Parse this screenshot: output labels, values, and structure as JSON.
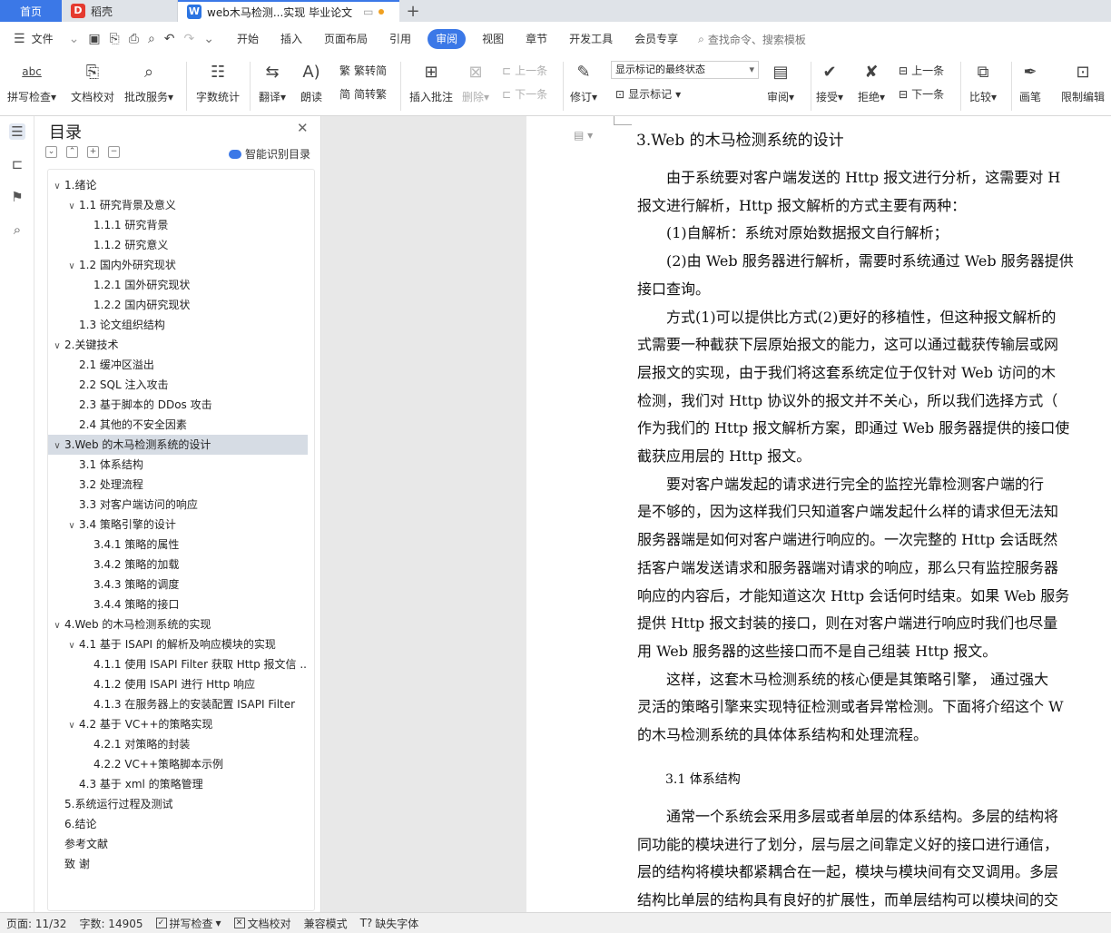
{
  "tabs": {
    "home": "首页",
    "daoke": "稻壳",
    "doc": "web木马检测...实现 毕业论文",
    "daoke_logo": "D",
    "doc_logo": "W"
  },
  "menubar": {
    "file": "文件",
    "items": [
      "开始",
      "插入",
      "页面布局",
      "引用",
      "审阅",
      "视图",
      "章节",
      "开发工具",
      "会员专享"
    ],
    "active": "审阅",
    "search": "查找命令、搜索模板"
  },
  "toolbar": {
    "spellcheck": "拼写检查",
    "proofread": "文档校对",
    "annotate_service": "批改服务",
    "word_count": "字数统计",
    "translate": "翻译",
    "read_aloud": "朗读",
    "to_traditional": "繁转简",
    "to_simplified": "简转繁",
    "insert_comment": "插入批注",
    "delete": "删除",
    "prev_comment": "上一条",
    "next_comment": "下一条",
    "revise": "修订",
    "markup_combo": "显示标记的最终状态",
    "show_markup": "显示标记",
    "review": "审阅",
    "accept": "接受",
    "reject": "拒绝",
    "prev_change": "上一条",
    "next_change": "下一条",
    "compare": "比较",
    "draw": "画笔",
    "restrict_edit": "限制编辑",
    "spell_icon_text": "abc"
  },
  "panel": {
    "title": "目录",
    "smart": "智能识别目录",
    "items": [
      {
        "text": "1.绪论",
        "level": 0,
        "toggle": "∨"
      },
      {
        "text": "1.1  研究背景及意义",
        "level": 1,
        "toggle": "∨"
      },
      {
        "text": "1.1.1 研究背景",
        "level": 2
      },
      {
        "text": "1.1.2  研究意义",
        "level": 2
      },
      {
        "text": "1.2  国内外研究现状",
        "level": 1,
        "toggle": "∨"
      },
      {
        "text": "1.2.1  国外研究现状",
        "level": 2
      },
      {
        "text": "1.2.2  国内研究现状",
        "level": 2
      },
      {
        "text": "1.3  论文组织结构",
        "level": 1
      },
      {
        "text": "2.关键技术",
        "level": 0,
        "toggle": "∨"
      },
      {
        "text": "2.1 缓冲区溢出",
        "level": 1
      },
      {
        "text": "2.2 SQL 注入攻击",
        "level": 1
      },
      {
        "text": "2.3 基于脚本的 DDos 攻击",
        "level": 1
      },
      {
        "text": "2.4 其他的不安全因素",
        "level": 1
      },
      {
        "text": "3.Web 的木马检测系统的设计",
        "level": 0,
        "toggle": "∨",
        "selected": true
      },
      {
        "text": "3.1 体系结构",
        "level": 1
      },
      {
        "text": "3.2 处理流程",
        "level": 1
      },
      {
        "text": "3.3 对客户端访问的响应",
        "level": 1
      },
      {
        "text": "3.4 策略引擎的设计",
        "level": 1,
        "toggle": "∨"
      },
      {
        "text": "3.4.1 策略的属性",
        "level": 2
      },
      {
        "text": "3.4.2 策略的加载",
        "level": 2
      },
      {
        "text": "3.4.3 策略的调度",
        "level": 2
      },
      {
        "text": "3.4.4 策略的接口",
        "level": 2
      },
      {
        "text": "4.Web 的木马检测系统的实现",
        "level": 0,
        "toggle": "∨"
      },
      {
        "text": "4.1 基于 ISAPI  的解析及响应模块的实现",
        "level": 1,
        "toggle": "∨"
      },
      {
        "text": "4.1.1 使用 ISAPI Filter 获取 Http 报文信 ...",
        "level": 2
      },
      {
        "text": "4.1.2 使用 ISAPI 进行 Http 响应",
        "level": 2
      },
      {
        "text": "4.1.3 在服务器上的安装配置 ISAPI Filter",
        "level": 2
      },
      {
        "text": "4.2 基于 VC++的策略实现",
        "level": 1,
        "toggle": "∨"
      },
      {
        "text": "4.2.1 对策略的封装",
        "level": 2
      },
      {
        "text": "4.2.2 VC++策略脚本示例",
        "level": 2
      },
      {
        "text": "4.3 基于 xml 的策略管理",
        "level": 1
      },
      {
        "text": "5.系统运行过程及测试",
        "level": 0
      },
      {
        "text": "6.结论",
        "level": 0
      },
      {
        "text": "参考文献",
        "level": 0
      },
      {
        "text": "致   谢",
        "level": 0
      }
    ]
  },
  "doc": {
    "heading": "3.Web 的木马检测系统的设计",
    "lines": [
      "　　由于系统要对客户端发送的 Http 报文进行分析，这需要对 H",
      "报文进行解析，Http 报文解析的方式主要有两种：",
      "　　(1)自解析：系统对原始数据报文自行解析；",
      "　　(2)由 Web 服务器进行解析，需要时系统通过 Web 服务器提供",
      "接口查询。",
      "　　方式(1)可以提供比方式(2)更好的移植性，但这种报文解析的",
      "式需要一种截获下层原始报文的能力，这可以通过截获传输层或网",
      "层报文的实现，由于我们将这套系统定位于仅针对 Web 访问的木",
      "检测，我们对 Http 协议外的报文并不关心，所以我们选择方式（",
      "作为我们的 Http 报文解析方案，即通过 Web 服务器提供的接口使",
      "截获应用层的 Http 报文。",
      "　　要对客户端发起的请求进行完全的监控光靠检测客户端的行",
      "是不够的，因为这样我们只知道客户端发起什么样的请求但无法知",
      "服务器端是如何对客户端进行响应的。一次完整的 Http 会话既然",
      "括客户端发送请求和服务器端对请求的响应，那么只有监控服务器",
      "响应的内容后，才能知道这次 Http 会话何时结束。如果 Web 服务",
      "提供 Http 报文封装的接口，则在对客户端进行响应时我们也尽量",
      "用 Web 服务器的这些接口而不是自己组装 Http 报文。",
      "　　这样，这套木马检测系统的核心便是其策略引擎，  通过强大",
      "灵活的策略引擎来实现特征检测或者异常检测。下面将介绍这个 W",
      "的木马检测系统的具体体系结构和处理流程。"
    ],
    "subheading": "3.1 体系结构",
    "lines2": [
      "　　通常一个系统会采用多层或者单层的体系结构。多层的结构将",
      "同功能的模块进行了划分，层与层之间靠定义好的接口进行通信，",
      "层的结构将模块都紧耦合在一起，模块与模块间有交叉调用。多层",
      "结构比单层的结构具有良好的扩展性，而单层结构可以模块间的交"
    ]
  },
  "status": {
    "page": "页面: 11/32",
    "words": "字数: 14905",
    "spell": "拼写检查",
    "proof": "文档校对",
    "compat": "兼容模式",
    "missing_font": "缺失字体"
  }
}
